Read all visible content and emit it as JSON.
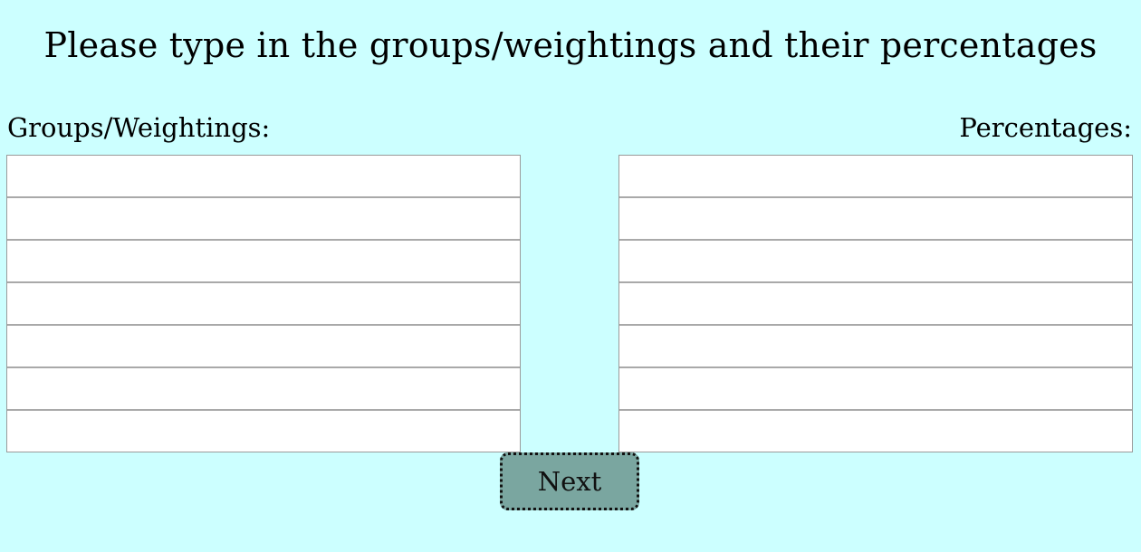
{
  "page": {
    "title": "Please type in the groups/weightings and their percentages"
  },
  "form": {
    "groups_label": "Groups/Weightings:",
    "percentages_label": "Percentages:",
    "groups": [
      "",
      "",
      "",
      "",
      "",
      "",
      ""
    ],
    "percentages": [
      "",
      "",
      "",
      "",
      "",
      "",
      ""
    ]
  },
  "actions": {
    "next_label": "Next"
  },
  "colors": {
    "background": "#ccffff",
    "button": "#7aa6a0"
  }
}
